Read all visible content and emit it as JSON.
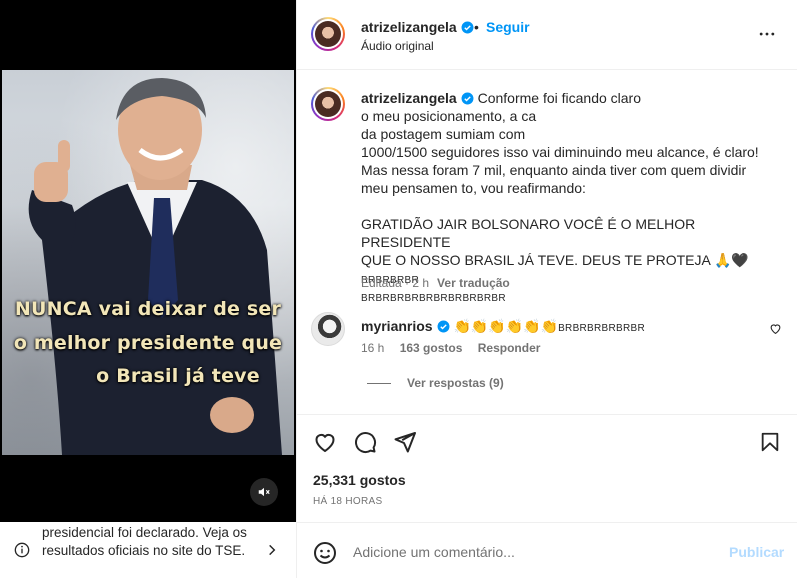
{
  "media": {
    "overlay_lines": [
      "NUNCA vai deixar de ser",
      "o melhor presidente que",
      "o Brasil já teve"
    ],
    "mute_icon": "speaker-muted-icon"
  },
  "notice": {
    "text": "presidencial foi declarado. Veja os resultados oficiais no site do TSE."
  },
  "header": {
    "username": "atrizelizangela",
    "dot": "•",
    "follow_label": "Seguir",
    "subtitle": "Áudio original"
  },
  "caption": {
    "username": "atrizelizangela",
    "line1": "Conforme foi ficando claro",
    "line2": "o meu posicionamento, a ca",
    "line3": "da postagem sumiam com",
    "line4": "1000/1500 seguidores isso vai diminuindo meu alcance, é claro!",
    "line5": "Mas nessa foram 7 mil, enquanto ainda tiver com quem dividir",
    "line6": "meu pensamen to, vou reafirmando:",
    "line7": "GRATIDÃO JAIR BOLSONARO VOCÊ É O MELHOR PRESIDENTE",
    "line8": "QUE O NOSSO BRASIL JÁ TEVE. DEUS TE PROTEJA 🙏🖤",
    "line8_tail": "BRBRBRBR",
    "line9": "BRBRBRBRBRBRBRBRBRBR",
    "edited": "Editada · 2 h",
    "translate": "Ver tradução"
  },
  "comment": {
    "username": "myrianrios",
    "claps": "👏👏👏👏👏👏",
    "tail": "BRBRBRBRBRBR",
    "time": "16 h",
    "likes": "163 gostos",
    "reply": "Responder",
    "view_replies": "Ver respostas (9)"
  },
  "stats": {
    "likes": "25,331 gostos",
    "time": "HÁ 18 HORAS"
  },
  "add_comment": {
    "placeholder": "Adicione um comentário...",
    "post_label": "Publicar"
  },
  "colors": {
    "accent": "#0095f6",
    "post_disabled": "#b3dbff",
    "muted_text": "#737373"
  }
}
